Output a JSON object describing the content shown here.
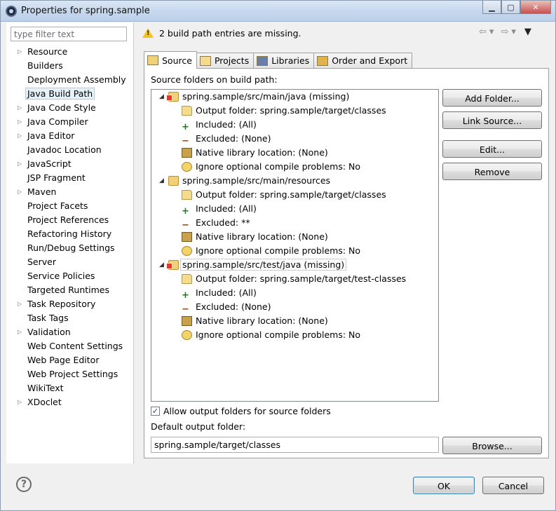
{
  "window": {
    "title": "Properties for spring.sample"
  },
  "sidebar": {
    "filter_placeholder": "type filter text",
    "items": [
      {
        "label": "Resource",
        "expandable": true
      },
      {
        "label": "Builders",
        "expandable": false
      },
      {
        "label": "Deployment Assembly",
        "expandable": false
      },
      {
        "label": "Java Build Path",
        "expandable": false,
        "selected": true
      },
      {
        "label": "Java Code Style",
        "expandable": true
      },
      {
        "label": "Java Compiler",
        "expandable": true
      },
      {
        "label": "Java Editor",
        "expandable": true
      },
      {
        "label": "Javadoc Location",
        "expandable": false
      },
      {
        "label": "JavaScript",
        "expandable": true
      },
      {
        "label": "JSP Fragment",
        "expandable": false
      },
      {
        "label": "Maven",
        "expandable": true
      },
      {
        "label": "Project Facets",
        "expandable": false
      },
      {
        "label": "Project References",
        "expandable": false
      },
      {
        "label": "Refactoring History",
        "expandable": false
      },
      {
        "label": "Run/Debug Settings",
        "expandable": false
      },
      {
        "label": "Server",
        "expandable": false
      },
      {
        "label": "Service Policies",
        "expandable": false
      },
      {
        "label": "Targeted Runtimes",
        "expandable": false
      },
      {
        "label": "Task Repository",
        "expandable": true
      },
      {
        "label": "Task Tags",
        "expandable": false
      },
      {
        "label": "Validation",
        "expandable": true
      },
      {
        "label": "Web Content Settings",
        "expandable": false
      },
      {
        "label": "Web Page Editor",
        "expandable": false
      },
      {
        "label": "Web Project Settings",
        "expandable": false
      },
      {
        "label": "WikiText",
        "expandable": false
      },
      {
        "label": "XDoclet",
        "expandable": true
      }
    ]
  },
  "header": {
    "message": "2 build path entries are missing."
  },
  "tabs": [
    {
      "label": "Source",
      "active": true
    },
    {
      "label": "Projects"
    },
    {
      "label": "Libraries"
    },
    {
      "label": "Order and Export"
    }
  ],
  "source": {
    "label": "Source folders on build path:",
    "folders": [
      {
        "name": "spring.sample/src/main/java (missing)",
        "missing": true,
        "children": [
          {
            "type": "output",
            "text": "Output folder: spring.sample/target/classes"
          },
          {
            "type": "included",
            "text": "Included: (All)"
          },
          {
            "type": "excluded",
            "text": "Excluded: (None)"
          },
          {
            "type": "native",
            "text": "Native library location: (None)"
          },
          {
            "type": "ignore",
            "text": "Ignore optional compile problems: No"
          }
        ]
      },
      {
        "name": "spring.sample/src/main/resources",
        "missing": false,
        "children": [
          {
            "type": "output",
            "text": "Output folder: spring.sample/target/classes"
          },
          {
            "type": "included",
            "text": "Included: (All)"
          },
          {
            "type": "excluded",
            "text": "Excluded: **"
          },
          {
            "type": "native",
            "text": "Native library location: (None)"
          },
          {
            "type": "ignore",
            "text": "Ignore optional compile problems: No"
          }
        ]
      },
      {
        "name": "spring.sample/src/test/java (missing)",
        "missing": true,
        "children": [
          {
            "type": "output",
            "text": "Output folder: spring.sample/target/test-classes"
          },
          {
            "type": "included",
            "text": "Included: (All)"
          },
          {
            "type": "excluded",
            "text": "Excluded: (None)"
          },
          {
            "type": "native",
            "text": "Native library location: (None)"
          },
          {
            "type": "ignore",
            "text": "Ignore optional compile problems: No"
          }
        ]
      }
    ],
    "buttons": {
      "add_folder": "Add Folder...",
      "link_source": "Link Source...",
      "edit": "Edit...",
      "remove": "Remove",
      "browse": "Browse..."
    },
    "allow_output_label": "Allow output folders for source folders",
    "allow_output_checked": true,
    "default_output_label": "Default output folder:",
    "default_output_value": "spring.sample/target/classes"
  },
  "footer": {
    "ok": "OK",
    "cancel": "Cancel"
  },
  "colors": {
    "selection": "#e5f1fb",
    "accent": "#3c7fb1",
    "warning": "#f5c422",
    "error": "#e03a2e"
  }
}
